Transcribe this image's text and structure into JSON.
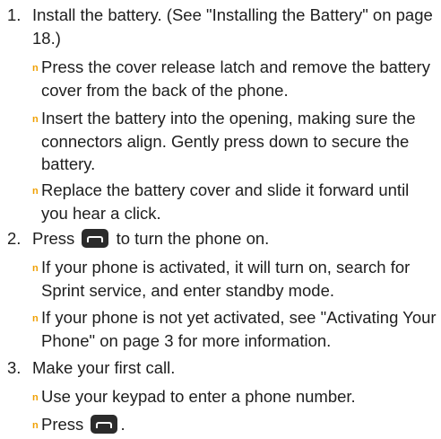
{
  "steps": [
    {
      "number": "1.",
      "title": "Install the battery. (See \"Installing the Battery\" on page 18.)",
      "bullets": [
        "Press the cover release latch and remove the battery cover from the back of the phone.",
        "Insert the battery into the opening, making sure the connectors align. Gently press down to secure the battery.",
        "Replace the battery cover and slide it forward until you hear a click."
      ]
    },
    {
      "number": "2.",
      "title_before": "Press",
      "title_after": "to turn the phone on.",
      "bullets": [
        "If your phone is activated, it will turn on, search for Sprint service, and enter standby mode.",
        "If your phone is not yet activated, see \"Activating Your Phone\" on page 3 for more information."
      ]
    },
    {
      "number": "3.",
      "title": "Make your first call.",
      "bullets": [
        "Use your keypad to enter a phone number."
      ],
      "last_bullet_before": "Press",
      "last_bullet_after": "."
    }
  ],
  "icons": {
    "key_icon": "end-power-key-icon",
    "bullet_icon": "orange-n-bullet-icon"
  },
  "colors": {
    "text": "#1e1e1e",
    "bullet": "#f0a000",
    "key": "#2b2b2b"
  }
}
